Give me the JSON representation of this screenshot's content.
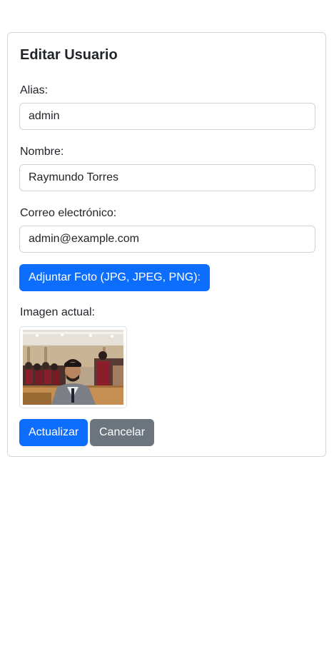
{
  "form": {
    "title": "Editar Usuario",
    "alias_label": "Alias:",
    "alias_value": "admin",
    "nombre_label": "Nombre:",
    "nombre_value": "Raymundo Torres",
    "email_label": "Correo electrónico:",
    "email_value": "admin@example.com",
    "attach_button": "Adjuntar Foto (JPG, JPEG, PNG):",
    "current_image_label": "Imagen actual:",
    "update_button": "Actualizar",
    "cancel_button": "Cancelar"
  },
  "colors": {
    "primary": "#0d6efd",
    "secondary": "#6c757d",
    "border": "#ced4da"
  }
}
